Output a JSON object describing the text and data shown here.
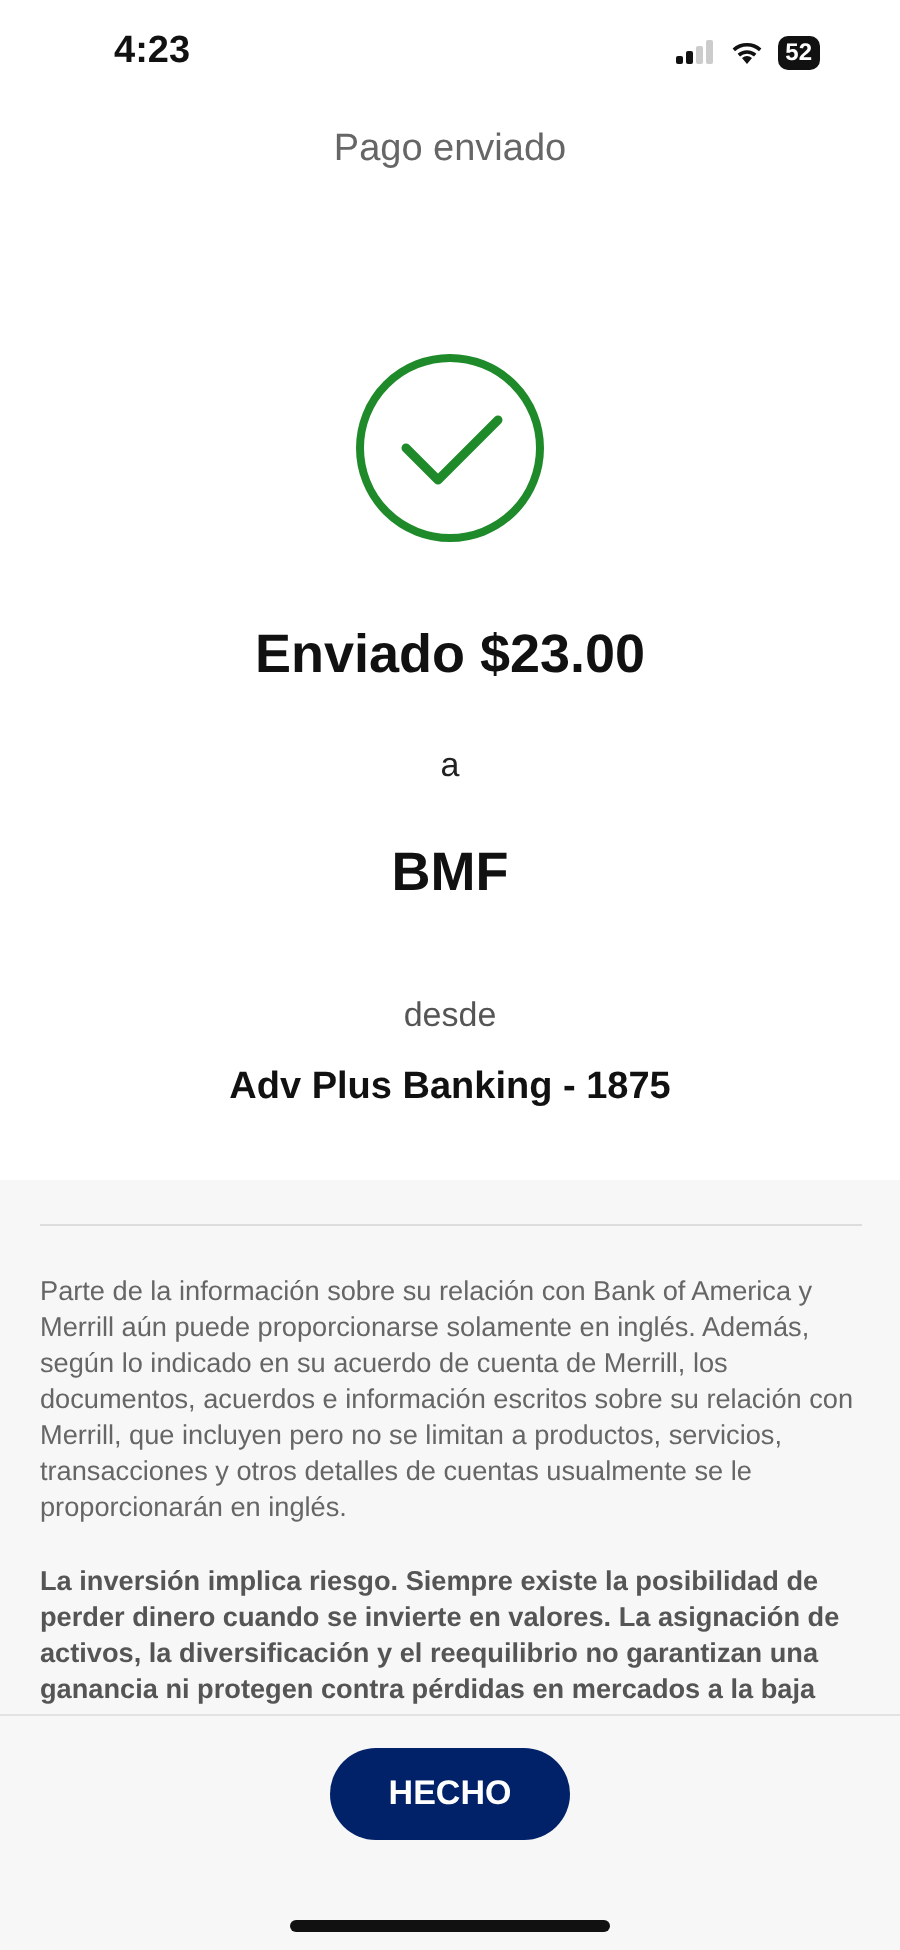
{
  "status_bar": {
    "time": "4:23",
    "battery": "52"
  },
  "header": {
    "title": "Pago enviado"
  },
  "confirmation": {
    "amount_line": "Enviado $23.00",
    "to_label": "a",
    "recipient": "BMF",
    "from_label": "desde",
    "account": "Adv Plus Banking - 1875"
  },
  "disclosures": [
    {
      "kind": "normal",
      "text": "Parte de la información sobre su relación con Bank of America y Merrill aún puede proporcionarse solamente en inglés. Además, según lo indicado en su acuerdo de cuenta de Merrill, los documentos, acuerdos e información escritos sobre su relación con Merrill, que incluyen pero no se limitan a productos, servicios, transacciones y otros detalles de cuentas usualmente se le proporcionarán en inglés."
    },
    {
      "kind": "bold",
      "text": "La inversión implica riesgo. Siempre existe la posibilidad de perder dinero cuando se invierte en valores. La asignación de activos, la diversificación y el reequilibrio no garantizan una ganancia ni protegen contra pérdidas en mercados a la baja"
    }
  ],
  "footer": {
    "button": "HECHO"
  }
}
